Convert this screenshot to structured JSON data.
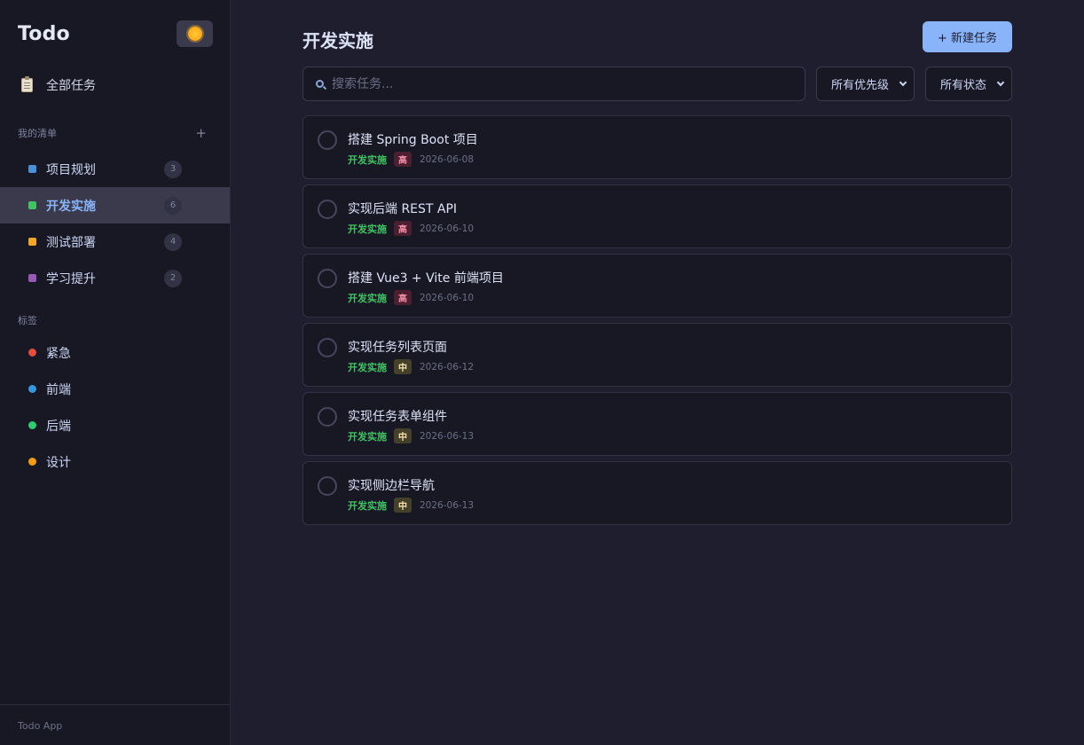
{
  "app": {
    "logo": "Todo",
    "footer": "Todo App"
  },
  "sidebar": {
    "all_tasks": "全部任务",
    "my_lists_title": "我的清单",
    "add_symbol": "+",
    "lists": [
      {
        "name": "项目规划",
        "count": "3",
        "color": "#4a90d9"
      },
      {
        "name": "开发实施",
        "count": "6",
        "color": "#40c463"
      },
      {
        "name": "测试部署",
        "count": "4",
        "color": "#f5a623"
      },
      {
        "name": "学习提升",
        "count": "2",
        "color": "#9b59b6"
      }
    ],
    "tags_title": "标签",
    "tags": [
      {
        "name": "紧急",
        "color": "#e74c3c"
      },
      {
        "name": "前端",
        "color": "#3498db"
      },
      {
        "name": "后端",
        "color": "#2ecc71"
      },
      {
        "name": "设计",
        "color": "#f39c12"
      }
    ]
  },
  "main": {
    "title": "开发实施",
    "new_task_label": "+ 新建任务",
    "search_placeholder": "搜索任务...",
    "priority_filter": "所有优先级",
    "status_filter": "所有状态",
    "tasks": [
      {
        "title": "搭建 Spring Boot 项目",
        "list": "开发实施",
        "priority": "高",
        "date": "2026-06-08"
      },
      {
        "title": "实现后端 REST API",
        "list": "开发实施",
        "priority": "高",
        "date": "2026-06-10"
      },
      {
        "title": "搭建 Vue3 + Vite 前端项目",
        "list": "开发实施",
        "priority": "高",
        "date": "2026-06-10"
      },
      {
        "title": "实现任务列表页面",
        "list": "开发实施",
        "priority": "中",
        "date": "2026-06-12"
      },
      {
        "title": "实现任务表单组件",
        "list": "开发实施",
        "priority": "中",
        "date": "2026-06-13"
      },
      {
        "title": "实现侧边栏导航",
        "list": "开发实施",
        "priority": "中",
        "date": "2026-06-13"
      }
    ]
  }
}
